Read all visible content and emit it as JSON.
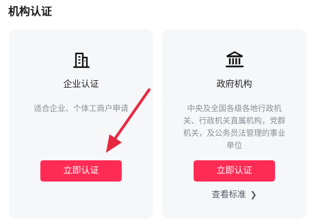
{
  "header": {
    "title": "机构认证"
  },
  "cards": [
    {
      "icon": "building-icon",
      "title": "企业认证",
      "description": "适合企业、个体工商户申请",
      "button": "立即认证"
    },
    {
      "icon": "government-building-icon",
      "title": "政府机构",
      "description": "中央及全国各级各地行政机关、行政机关直属机构，党群机关，及公务员法管理的事业单位",
      "button": "立即认证",
      "link": "查看标准"
    }
  ],
  "colors": {
    "accent": "#fe2c55",
    "annotation_arrow": "#e8283f",
    "card_bg": "#f6f7f9"
  }
}
